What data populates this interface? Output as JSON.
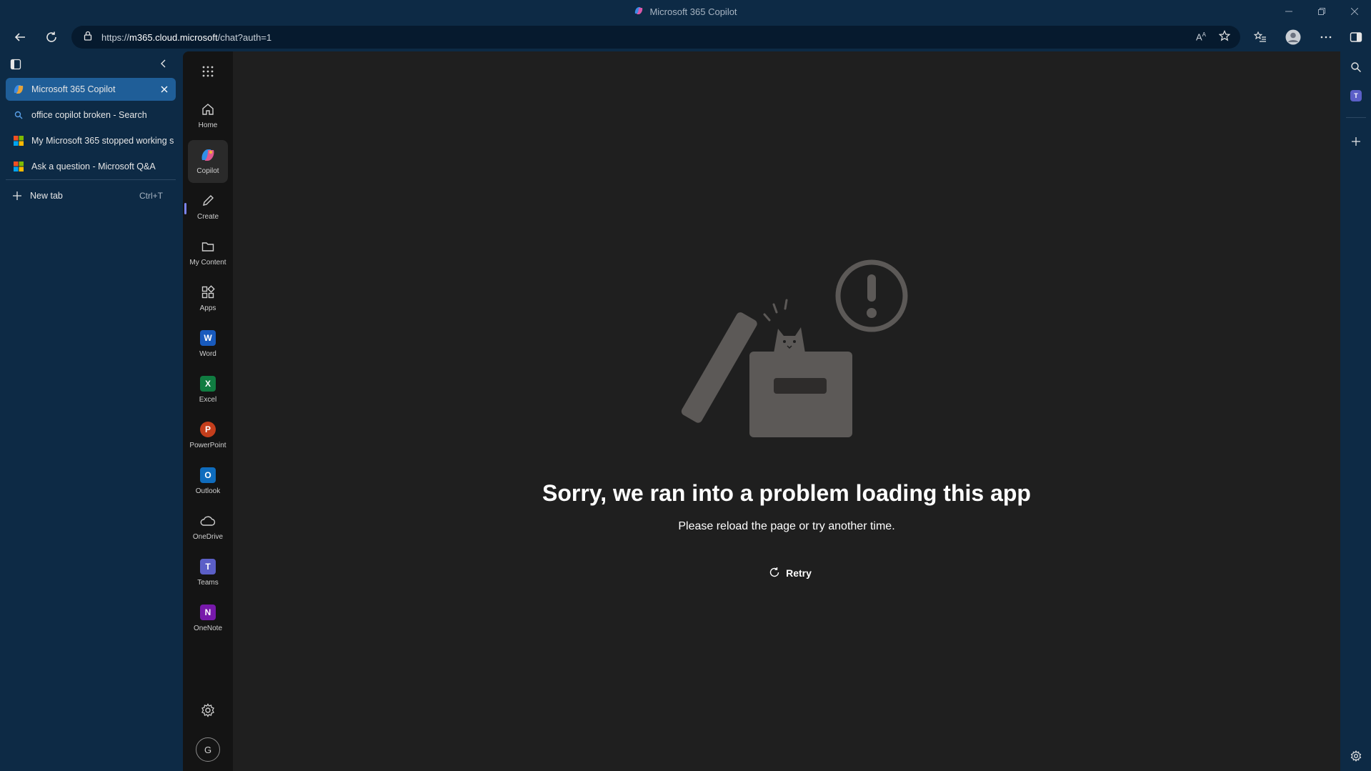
{
  "window": {
    "title": "Microsoft 365 Copilot"
  },
  "address_bar": {
    "url_scheme": "https://",
    "url_host": "m365.cloud.microsoft",
    "url_path": "/chat?auth=1"
  },
  "tabs": [
    {
      "label": "Microsoft 365 Copilot",
      "icon": "copilot-icon",
      "active": true
    },
    {
      "label": "office copilot broken - Search",
      "icon": "search-icon",
      "active": false
    },
    {
      "label": "My Microsoft 365 stopped working s",
      "icon": "microsoft-logo-icon",
      "active": false
    },
    {
      "label": "Ask a question - Microsoft Q&A",
      "icon": "microsoft-logo-icon",
      "active": false
    }
  ],
  "new_tab": {
    "label": "New tab",
    "shortcut": "Ctrl+T"
  },
  "rail": {
    "items": [
      {
        "label": "Home",
        "icon": "home-icon"
      },
      {
        "label": "Copilot",
        "icon": "copilot-icon"
      },
      {
        "label": "Create",
        "icon": "pencil-icon"
      },
      {
        "label": "My Content",
        "icon": "folder-icon"
      },
      {
        "label": "Apps",
        "icon": "apps-icon"
      },
      {
        "label": "Word",
        "icon": "word-icon",
        "letter": "W",
        "color": "#185abd"
      },
      {
        "label": "Excel",
        "icon": "excel-icon",
        "letter": "X",
        "color": "#107c41"
      },
      {
        "label": "PowerPoint",
        "icon": "powerpoint-icon",
        "letter": "P",
        "color": "#c43e1c"
      },
      {
        "label": "Outlook",
        "icon": "outlook-icon",
        "letter": "O",
        "color": "#0f6cbd"
      },
      {
        "label": "OneDrive",
        "icon": "cloud-icon"
      },
      {
        "label": "Teams",
        "icon": "teams-icon",
        "letter": "T",
        "color": "#5b5fc7"
      },
      {
        "label": "OneNote",
        "icon": "onenote-icon",
        "letter": "N",
        "color": "#7719aa"
      }
    ],
    "avatar_initial": "G"
  },
  "error": {
    "title": "Sorry, we ran into a problem loading this app",
    "subtitle": "Please reload the page or try another time.",
    "retry_label": "Retry"
  },
  "colors": {
    "browser_frame": "#0d2a45",
    "active_tab": "#1f5e98",
    "content_bg": "#1f1f1f",
    "rail_bg": "#141414"
  }
}
